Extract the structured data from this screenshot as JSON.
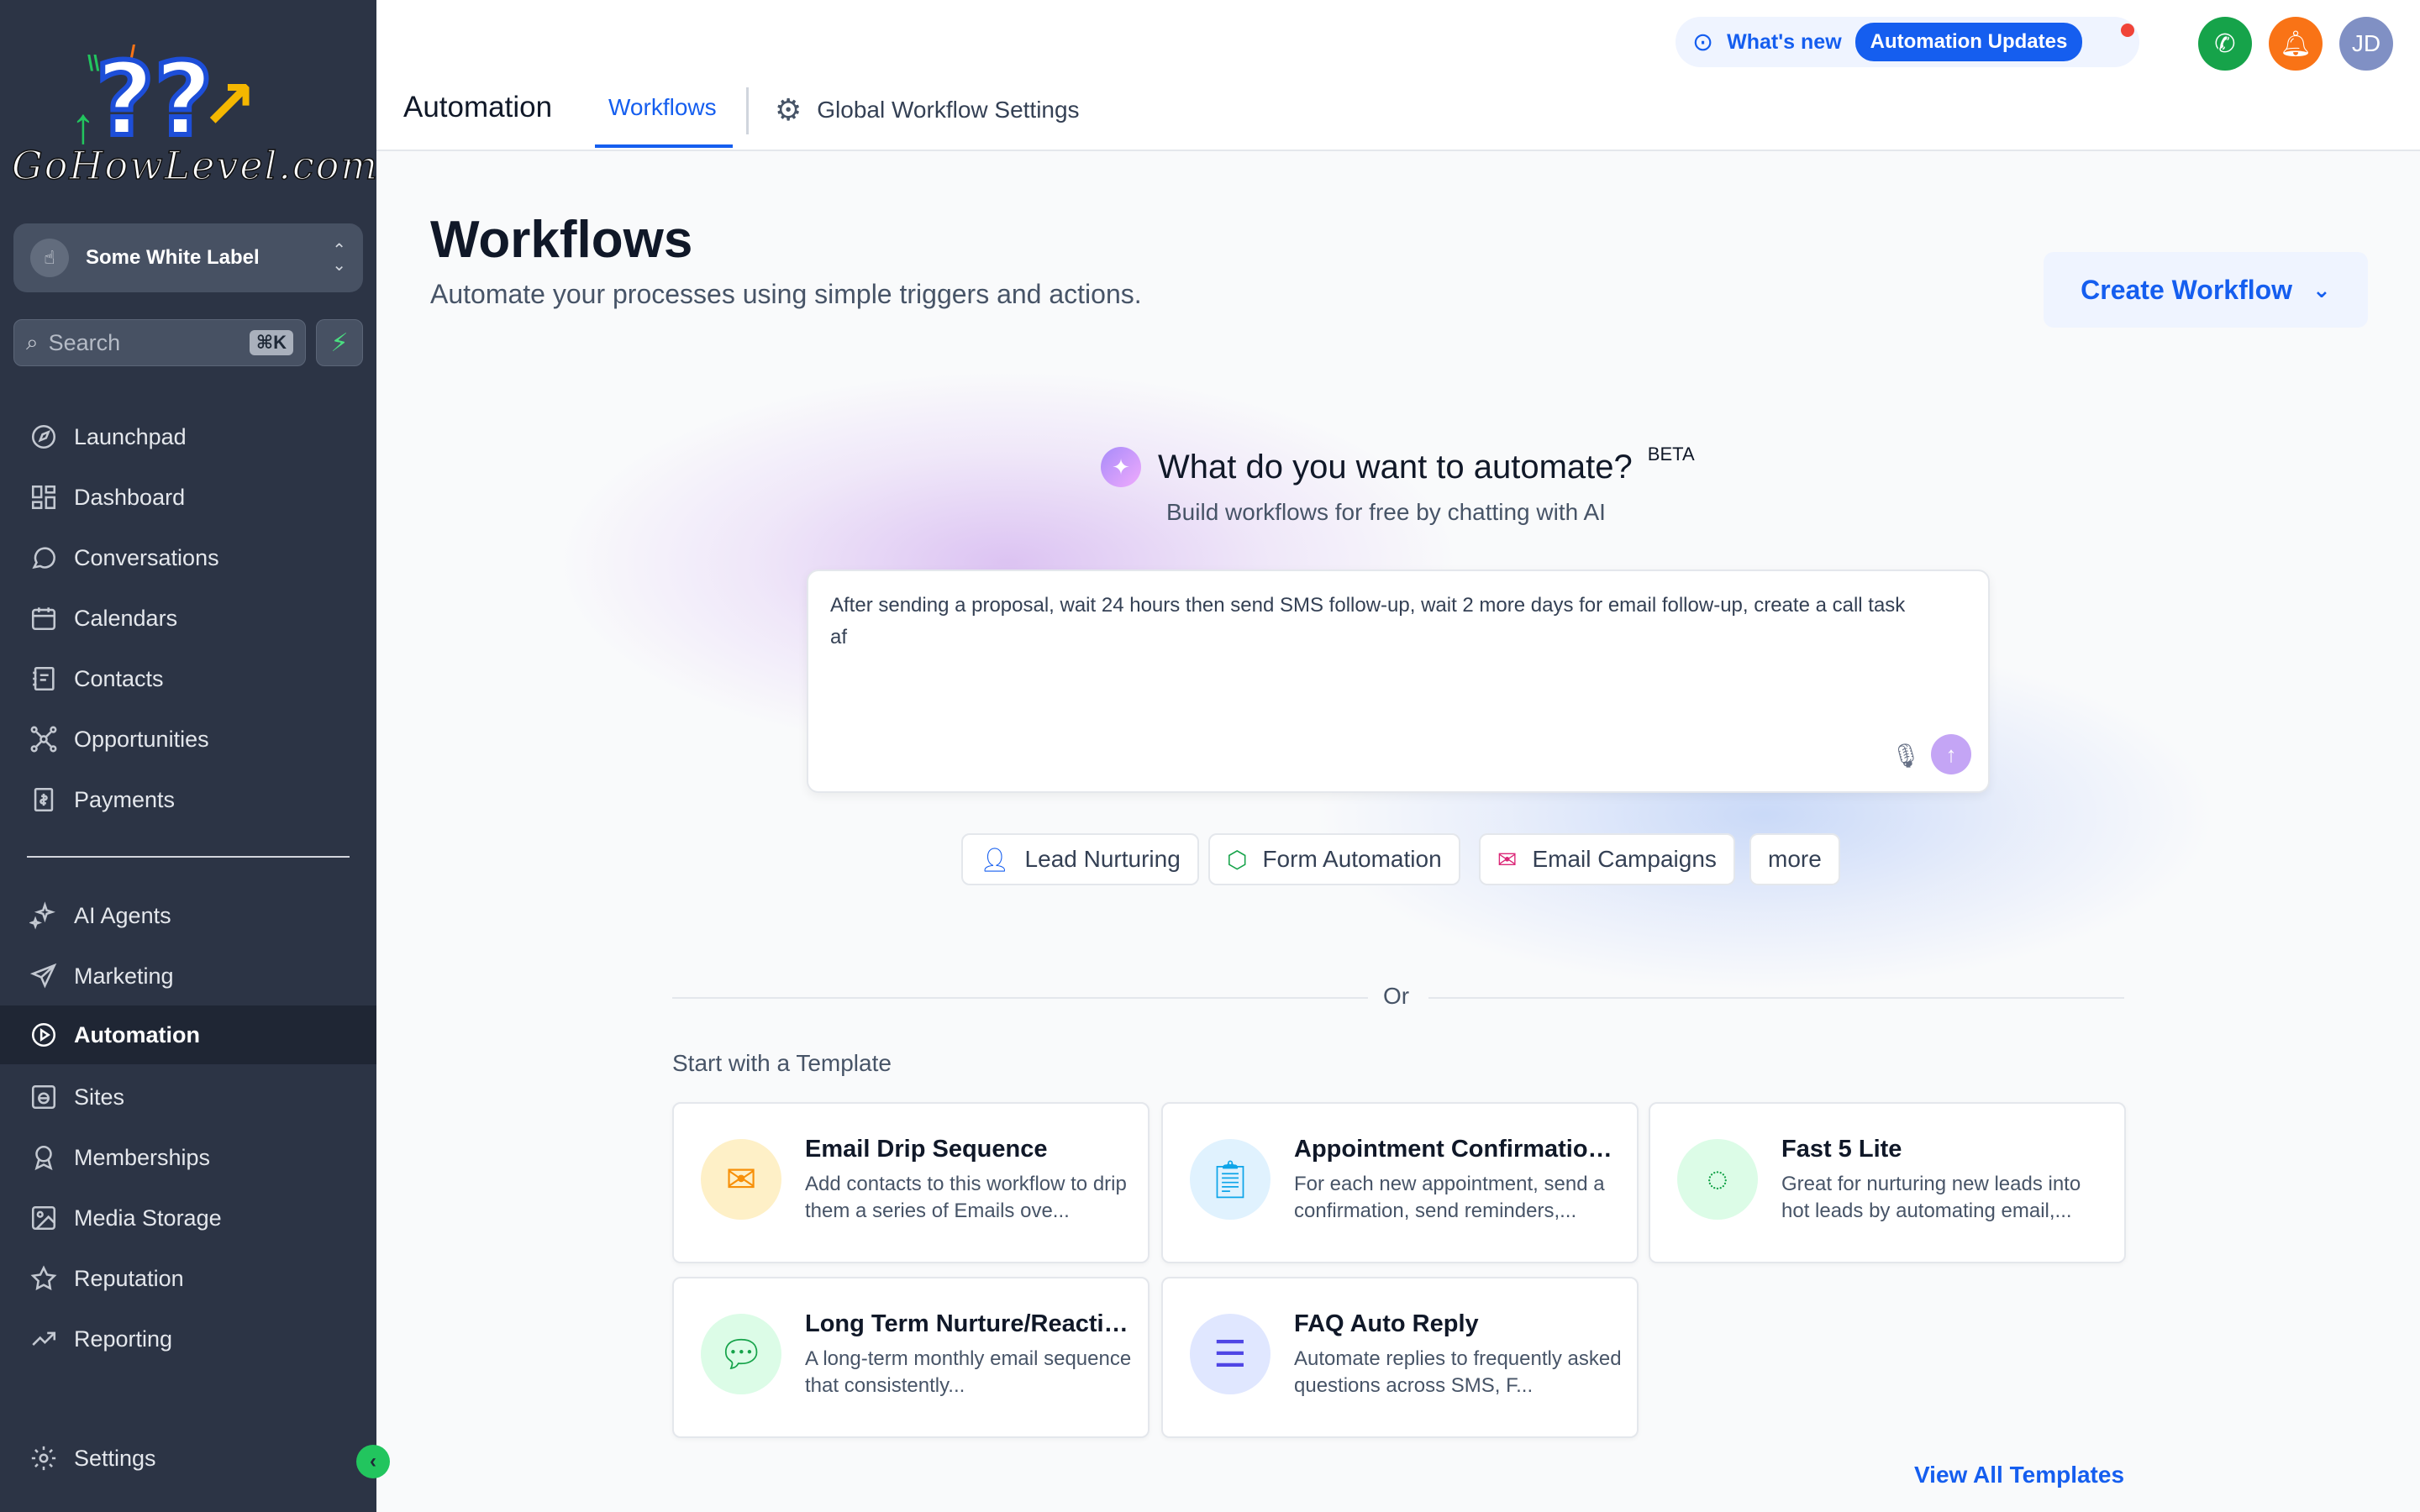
{
  "sidebar": {
    "logo_text": "GoHowLevel.com",
    "account_name": "Some White Label",
    "search_placeholder": "Search",
    "search_shortcut": "⌘K",
    "items": [
      {
        "label": "Launchpad"
      },
      {
        "label": "Dashboard"
      },
      {
        "label": "Conversations"
      },
      {
        "label": "Calendars"
      },
      {
        "label": "Contacts"
      },
      {
        "label": "Opportunities"
      },
      {
        "label": "Payments"
      },
      {
        "label": "AI Agents"
      },
      {
        "label": "Marketing"
      },
      {
        "label": "Automation",
        "active": true
      },
      {
        "label": "Sites"
      },
      {
        "label": "Memberships"
      },
      {
        "label": "Media Storage"
      },
      {
        "label": "Reputation"
      },
      {
        "label": "Reporting"
      },
      {
        "label": "Settings"
      }
    ]
  },
  "header": {
    "app_title": "Automation",
    "tabs": [
      {
        "label": "Workflows",
        "active": true
      },
      {
        "label": "Global Workflow Settings"
      }
    ],
    "whats_new_label": "What's new",
    "updates_pill": "Automation Updates",
    "user_initials": "JD"
  },
  "main": {
    "title": "Workflows",
    "subtitle": "Automate your processes using simple triggers and actions.",
    "create_button": "Create Workflow",
    "ai": {
      "title": "What do you want to automate?",
      "beta": "BETA",
      "subtitle": "Build workflows for free by chatting with AI",
      "prompt_value": "After sending a proposal, wait 24 hours then send SMS follow-up, wait 2 more days for email follow-up, create a call task af"
    },
    "chips": [
      {
        "label": "Lead Nurturing"
      },
      {
        "label": "Form Automation"
      },
      {
        "label": "Email Campaigns"
      },
      {
        "label": "more"
      }
    ],
    "or_label": "Or",
    "templates_heading": "Start with a Template",
    "templates": [
      {
        "title": "Email Drip Sequence",
        "desc": "Add contacts to this workflow to drip them a series of Emails ove..."
      },
      {
        "title": "Appointment Confirmation ...",
        "desc": "For each new appointment, send a confirmation, send reminders,..."
      },
      {
        "title": "Fast 5 Lite",
        "desc": "Great for nurturing new leads into hot leads by automating email,..."
      },
      {
        "title": "Long Term Nurture/Reactiv...",
        "desc": "A long-term monthly email sequence that consistently..."
      },
      {
        "title": "FAQ Auto Reply",
        "desc": "Automate replies to frequently asked questions across SMS, F..."
      }
    ],
    "view_all": "View All Templates"
  },
  "colors": {
    "sidebar_bg": "#2c3445",
    "accent": "#155eef",
    "phone": "#16a34a",
    "bell": "#f97316",
    "avatar": "#8090c4"
  }
}
